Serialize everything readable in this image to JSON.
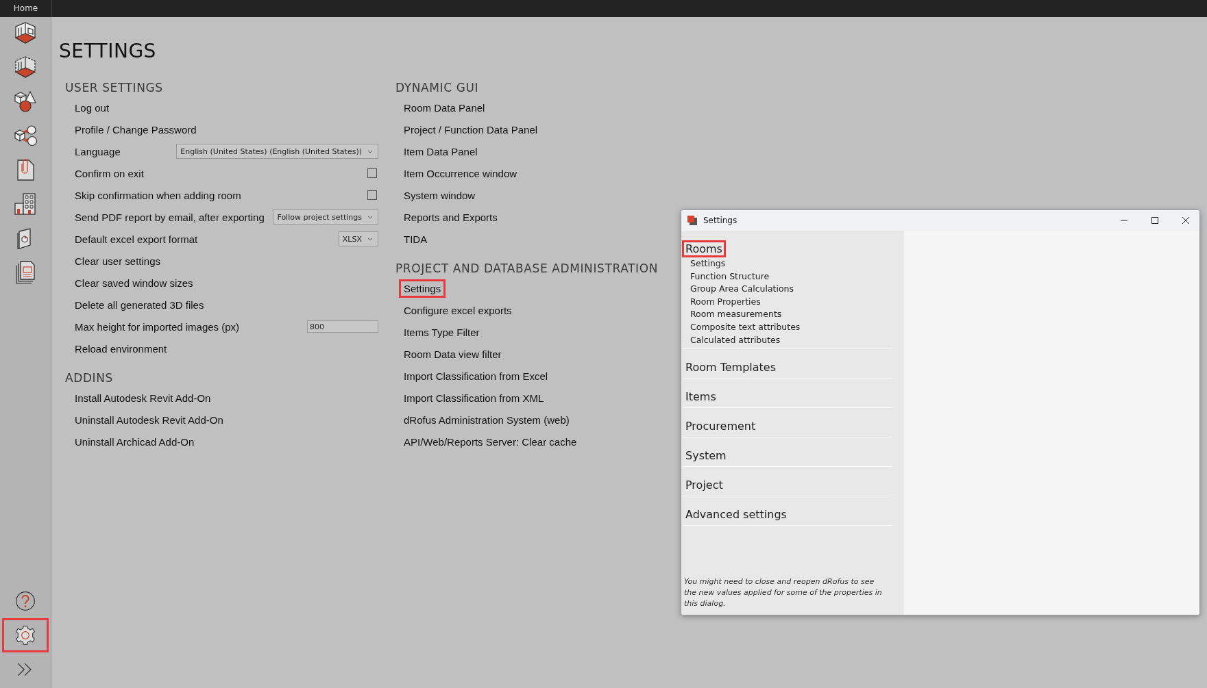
{
  "top_bar": {
    "tab": "Home"
  },
  "sidebar": {
    "bottom": [
      {
        "kind": "help",
        "highlighted": false
      },
      {
        "kind": "settings",
        "highlighted": true
      },
      {
        "kind": "expand",
        "highlighted": false
      }
    ]
  },
  "page_title": "SETTINGS",
  "left_sections": [
    {
      "title": "USER SETTINGS",
      "rows": [
        {
          "kind": "action",
          "label": "Log out"
        },
        {
          "kind": "action",
          "label": "Profile / Change Password"
        },
        {
          "kind": "dropdown",
          "label": "Language",
          "value": "English (United States) (English (United States))"
        },
        {
          "kind": "checkbox",
          "label": "Confirm on exit",
          "checked": false
        },
        {
          "kind": "checkbox",
          "label": "Skip confirmation when adding room",
          "checked": false
        },
        {
          "kind": "dropdown",
          "label": "Send PDF report by email, after exporting",
          "value": "Follow project settings"
        },
        {
          "kind": "dropdown",
          "label": "Default excel export format",
          "value": "XLSX"
        },
        {
          "kind": "action",
          "label": "Clear user settings"
        },
        {
          "kind": "action",
          "label": "Clear saved window sizes"
        },
        {
          "kind": "action",
          "label": "Delete all generated 3D files"
        },
        {
          "kind": "input",
          "label": "Max height for imported images (px)",
          "value": "800"
        },
        {
          "kind": "action",
          "label": "Reload environment"
        }
      ]
    },
    {
      "title": "ADDINS",
      "rows": [
        {
          "kind": "action",
          "label": "Install Autodesk Revit Add-On"
        },
        {
          "kind": "action",
          "label": "Uninstall Autodesk Revit Add-On"
        },
        {
          "kind": "action",
          "label": "Uninstall Archicad Add-On"
        }
      ]
    }
  ],
  "right_sections": [
    {
      "title": "DYNAMIC GUI",
      "items": [
        {
          "label": "Room Data Panel",
          "highlighted": false
        },
        {
          "label": "Project / Function Data Panel",
          "highlighted": false
        },
        {
          "label": "Item Data Panel",
          "highlighted": false
        },
        {
          "label": "Item Occurrence window",
          "highlighted": false
        },
        {
          "label": "System window",
          "highlighted": false
        },
        {
          "label": "Reports and Exports",
          "highlighted": false
        },
        {
          "label": "TIDA",
          "highlighted": false
        }
      ]
    },
    {
      "title": "PROJECT AND DATABASE ADMINISTRATION",
      "items": [
        {
          "label": "Settings",
          "highlighted": true
        },
        {
          "label": "Configure excel exports",
          "highlighted": false
        },
        {
          "label": "Items Type Filter",
          "highlighted": false
        },
        {
          "label": "Room Data view filter",
          "highlighted": false
        },
        {
          "label": "Import Classification from Excel",
          "highlighted": false
        },
        {
          "label": "Import Classification from XML",
          "highlighted": false
        },
        {
          "label": "dRofus Administration System (web)",
          "highlighted": false
        },
        {
          "label": "API/Web/Reports Server: Clear cache",
          "highlighted": false
        }
      ]
    }
  ],
  "dialog": {
    "title": "Settings",
    "categories": [
      {
        "label": "Rooms",
        "highlighted": true,
        "children": [
          {
            "label": "Settings"
          },
          {
            "label": "Function Structure"
          },
          {
            "label": "Group Area Calculations"
          },
          {
            "label": "Room Properties"
          },
          {
            "label": "Room measurements"
          },
          {
            "label": "Composite text attributes"
          },
          {
            "label": "Calculated attributes"
          }
        ]
      },
      {
        "label": "Room Templates",
        "highlighted": false
      },
      {
        "label": "Items",
        "highlighted": false
      },
      {
        "label": "Procurement",
        "highlighted": false
      },
      {
        "label": "System",
        "highlighted": false
      },
      {
        "label": "Project",
        "highlighted": false
      },
      {
        "label": "Advanced settings",
        "highlighted": false
      }
    ],
    "note": "You might need to close and reopen dRofus to see the new values applied for some of the properties in this dialog."
  }
}
